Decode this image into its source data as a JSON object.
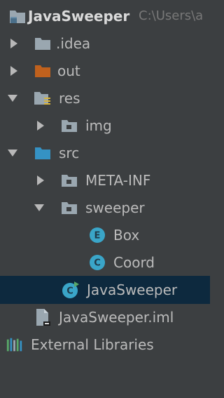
{
  "project": {
    "name": "JavaSweeper",
    "path": "C:\\Users\\a"
  },
  "tree": {
    "idea": "​.idea",
    "out": "out",
    "res": "res",
    "img": "img",
    "src": "src",
    "meta_inf": "META-INF",
    "sweeper": "sweeper",
    "box": "Box",
    "coord": "Coord",
    "javasweeper_class": "JavaSweeper",
    "iml": "JavaSweeper.iml",
    "external_libraries": "External Libraries"
  },
  "icon_badges": {
    "enum": "E",
    "class": "C"
  },
  "colors": {
    "background": "#3c3f41",
    "selection": "#0d293e",
    "folder_gray": "#9aa7b0",
    "folder_orange": "#c0611d",
    "folder_blue": "#3592c4",
    "class_teal": "#3aa5c8"
  }
}
